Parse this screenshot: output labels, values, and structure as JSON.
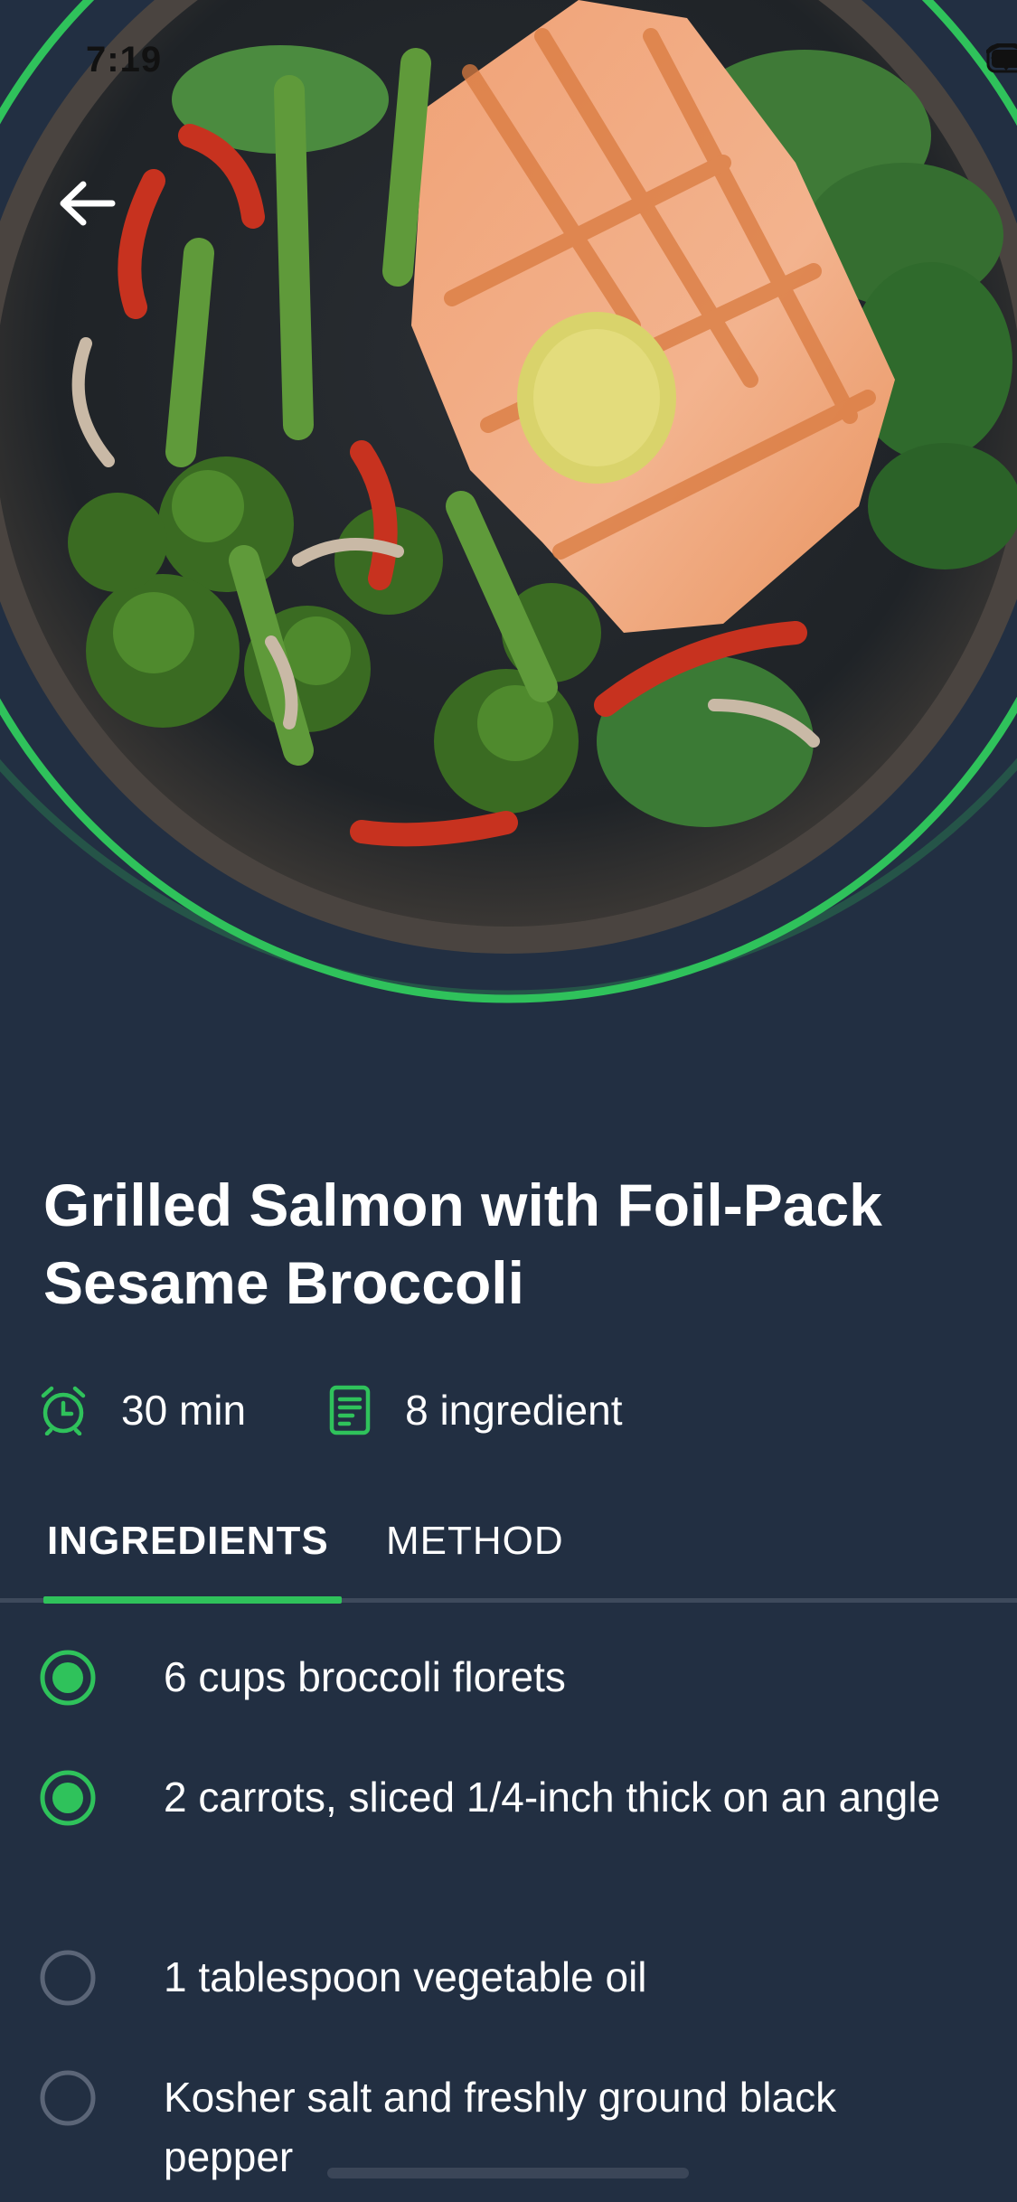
{
  "status_bar": {
    "time": "7:19"
  },
  "recipe": {
    "title": "Grilled Salmon with Foil-Pack Sesame Broccoli",
    "duration": "30 min",
    "ingredient_count": "8 ingredient"
  },
  "tabs": [
    {
      "label": "INGREDIENTS",
      "selected": true
    },
    {
      "label": "METHOD",
      "selected": false
    }
  ],
  "ingredients": [
    {
      "text": "6 cups broccoli florets",
      "checked": true
    },
    {
      "text": "2 carrots, sliced 1/4-inch thick on an angle",
      "checked": true
    },
    {
      "text": "1 tablespoon vegetable oil",
      "checked": false
    },
    {
      "text": "Kosher salt and freshly ground black pepper",
      "checked": false
    }
  ],
  "colors": {
    "background": "#222f42",
    "accent": "#2fc25b",
    "unchecked": "#5b6577"
  },
  "icons": [
    "back-arrow-icon",
    "alarm-clock-icon",
    "document-list-icon",
    "wifi-icon",
    "battery-icon"
  ]
}
